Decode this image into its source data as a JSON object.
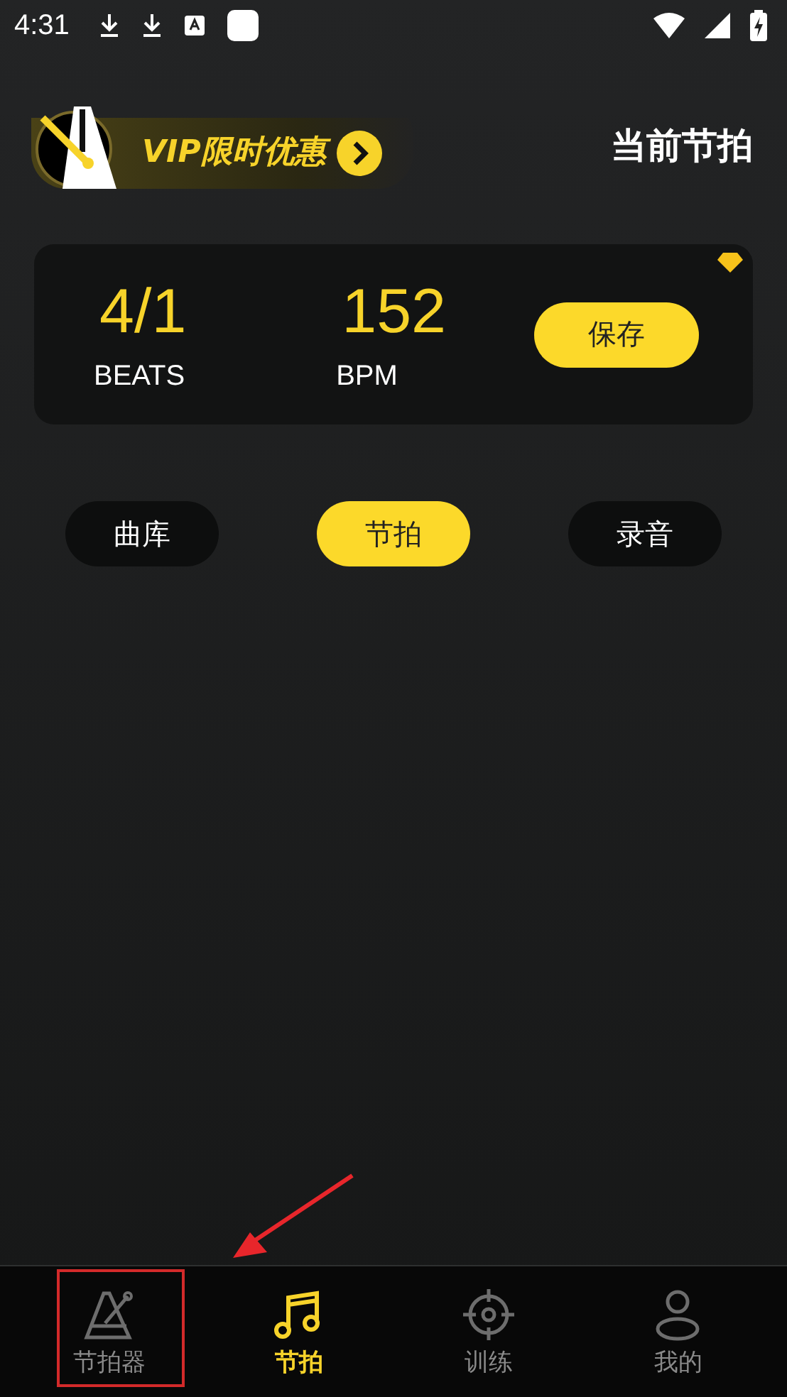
{
  "status_bar": {
    "time": "4:31"
  },
  "header": {
    "vip_banner": "VIP限时优惠",
    "title": "当前节拍"
  },
  "card": {
    "stats": [
      {
        "value": "4/1",
        "label": "BEATS"
      },
      {
        "value": "152",
        "label": "BPM"
      }
    ],
    "save_button": "保存"
  },
  "modes": [
    {
      "label": "曲库",
      "selected": false
    },
    {
      "label": "节拍",
      "selected": true
    },
    {
      "label": "录音",
      "selected": false
    }
  ],
  "bottom_nav": [
    {
      "kind": "metronome",
      "label": "节拍器",
      "selected": false
    },
    {
      "kind": "music",
      "label": "节拍",
      "selected": true
    },
    {
      "kind": "target",
      "label": "训练",
      "selected": false
    },
    {
      "kind": "person",
      "label": "我的",
      "selected": false
    }
  ]
}
